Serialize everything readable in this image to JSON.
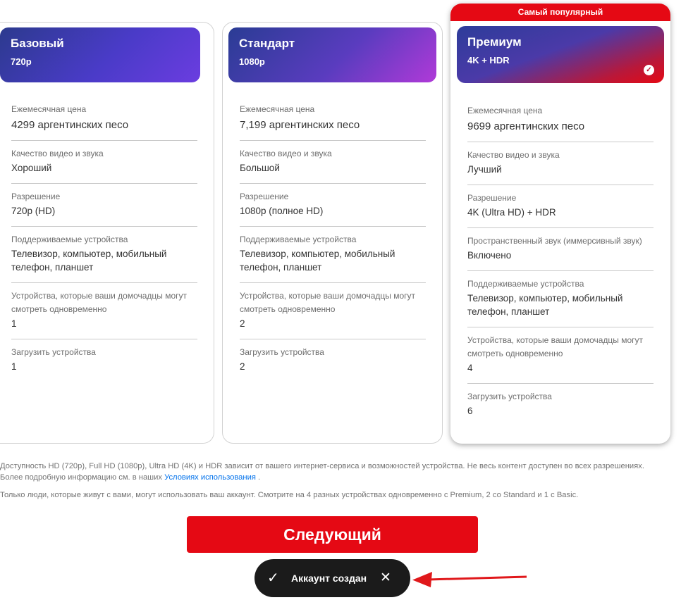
{
  "plans": [
    {
      "id": "basic",
      "name": "Базовый",
      "resolution_badge": "720p",
      "attributes": [
        {
          "label": "Ежемесячная цена",
          "value": "4299 аргентинских песо"
        },
        {
          "label": "Качество видео и звука",
          "value": "Хороший"
        },
        {
          "label": "Разрешение",
          "value": "720p (HD)"
        },
        {
          "label": "Поддерживаемые устройства",
          "value": "Телевизор, компьютер, мобильный телефон, планшет"
        },
        {
          "label": "Устройства, которые ваши домочадцы могут смотреть одновременно",
          "value": "1"
        },
        {
          "label": "Загрузить устройства",
          "value": "1"
        }
      ]
    },
    {
      "id": "standard",
      "name": "Стандарт",
      "resolution_badge": "1080p",
      "attributes": [
        {
          "label": "Ежемесячная цена",
          "value": "7,199 аргентинских песо"
        },
        {
          "label": "Качество видео и звука",
          "value": "Большой"
        },
        {
          "label": "Разрешение",
          "value": "1080p (полное HD)"
        },
        {
          "label": "Поддерживаемые устройства",
          "value": "Телевизор, компьютер, мобильный телефон, планшет"
        },
        {
          "label": "Устройства, которые ваши домочадцы могут смотреть одновременно",
          "value": "2"
        },
        {
          "label": "Загрузить устройства",
          "value": "2"
        }
      ]
    },
    {
      "id": "premium",
      "name": "Премиум",
      "resolution_badge": "4K + HDR",
      "popular_label": "Самый популярный",
      "selected_icon": "checkmark-circle-icon",
      "attributes": [
        {
          "label": "Ежемесячная цена",
          "value": "9699 аргентинских песо"
        },
        {
          "label": "Качество видео и звука",
          "value": "Лучший"
        },
        {
          "label": "Разрешение",
          "value": "4K (Ultra HD) + HDR"
        },
        {
          "label": "Пространственный звук (иммерсивный звук)",
          "value": "Включено"
        },
        {
          "label": "Поддерживаемые устройства",
          "value": "Телевизор, компьютер, мобильный телефон, планшет"
        },
        {
          "label": "Устройства, которые ваши домочадцы могут смотреть одновременно",
          "value": "4"
        },
        {
          "label": "Загрузить устройства",
          "value": "6"
        }
      ]
    }
  ],
  "disclaimer": {
    "availability_text": "Доступность HD (720p), Full HD (1080p), Ultra HD (4K) и HDR зависит от вашего интернет-сервиса и возможностей устройства. Не весь контент доступен во всех разрешениях. Более подробную информацию см. в наших",
    "terms_link": "Условиях использования",
    "availability_end": ".",
    "household_text": "Только люди, которые живут с вами, могут использовать ваш аккаунт. Смотрите на 4 разных устройствах одновременно с Premium, 2 со Standard и 1 с Basic."
  },
  "next_button": "Следующий",
  "toast": {
    "icon": "checkmark-icon",
    "message": "Аккаунт создан",
    "close_icon": "close-icon"
  },
  "annotation": {
    "icon": "red-arrow-icon",
    "color": "#e0181b"
  },
  "colors": {
    "brand_red": "#e50914",
    "link": "#0071eb"
  }
}
